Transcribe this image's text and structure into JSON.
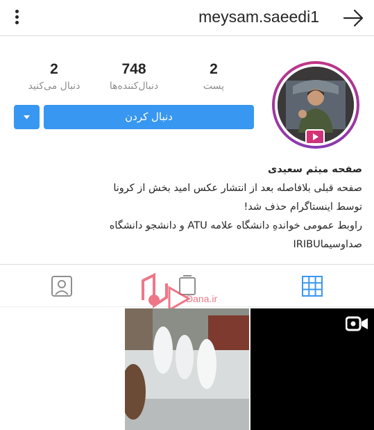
{
  "header": {
    "username": "meysam.saeedi1",
    "menu_icon": "more-vertical-icon",
    "back_icon": "arrow-right-icon"
  },
  "stats": {
    "following": {
      "count": "2",
      "label": "دنبال می‌کنید"
    },
    "followers": {
      "count": "748",
      "label": "دنبال‌کننده‌ها"
    },
    "posts": {
      "count": "2",
      "label": "پست"
    }
  },
  "actions": {
    "follow_label": "دنبال کردن",
    "dropdown_icon": "caret-down-icon"
  },
  "bio": {
    "name": "صفحه میثم سعیدی",
    "line1": "صفحه قبلی بلافاصله بعد از انتشار عکس امید بخش از کرونا",
    "line2": "توسط اینستاگرام حذف شد!",
    "line3": "راوبط عمومی خواندهِ دانشگاه علامه ATU و دانشجو دانشگاه",
    "line4": "صداوسیماIRIBU"
  },
  "tabs": {
    "grid_icon": "grid-icon",
    "igtv_icon": "igtv-icon",
    "tagged_icon": "tagged-person-icon"
  },
  "watermark": {
    "text": "Dana.ir"
  },
  "colors": {
    "accent": "#3897f0",
    "ring": "#c13584",
    "muted_text": "#8e8e8e",
    "divider": "#dbdbdb"
  }
}
